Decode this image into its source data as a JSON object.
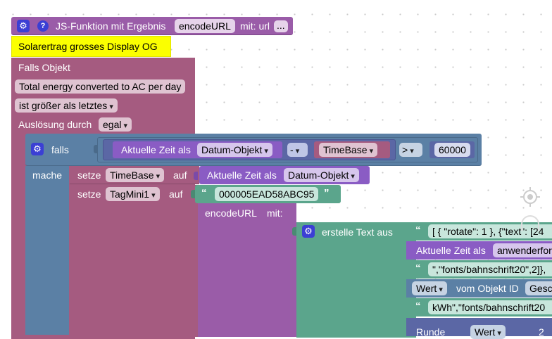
{
  "function_block": {
    "title": "JS-Funktion mit Ergebnis",
    "name": "encodeURL",
    "param_label": "mit: url",
    "more": "...",
    "comment": "Solarertrag grosses Display OG"
  },
  "trigger": {
    "falls_objekt": "Falls Objekt",
    "object_name": "Total energy converted to AC per day",
    "condition": "ist größer als letztes",
    "ausloesung_label": "Auslösung durch",
    "ausloesung_value": "egal"
  },
  "if_block": {
    "falls": "falls",
    "mache": "mache",
    "time_label": "Aktuelle Zeit als",
    "time_format": "Datum-Objekt",
    "minus": "-",
    "timebase_var": "TimeBase",
    "compare_op": ">",
    "compare_value": "60000"
  },
  "set1": {
    "setze": "setze",
    "var": "TimeBase",
    "auf": "auf",
    "value_label": "Aktuelle Zeit als",
    "value_format": "Datum-Objekt"
  },
  "set2": {
    "setze": "setze",
    "var": "TagMini1",
    "auf": "auf",
    "value": "000005EAD58ABC95"
  },
  "encode_call": {
    "label": "encodeURL",
    "mit": "mit:"
  },
  "create_text": {
    "label": "erstelle Text aus",
    "item1": "[ { \"rotate\": 1 },  {\"text\": [24",
    "item2_label": "Aktuelle Zeit als",
    "item2_value": "anwenderfor",
    "item3": "\",\"fonts/bahnschrift20\",2]},",
    "item4_dropdown": "Wert",
    "item4_label": "vom Objekt ID",
    "item4_value": "Gesc",
    "item5": " kWh\",\"fonts/bahnschrift20",
    "item6_label": "Runde",
    "item6_dropdown": "Wert",
    "item6_extra": "2"
  },
  "colors": {
    "procedure": "#9a5ca8",
    "trigger": "#a55b80",
    "logic": "#5b80a5",
    "variable": "#a55b80",
    "text": "#5ba58c",
    "time": "#8a5cc4",
    "comment": "#fbff00"
  },
  "workspace_controls": [
    "recenter-icon"
  ]
}
